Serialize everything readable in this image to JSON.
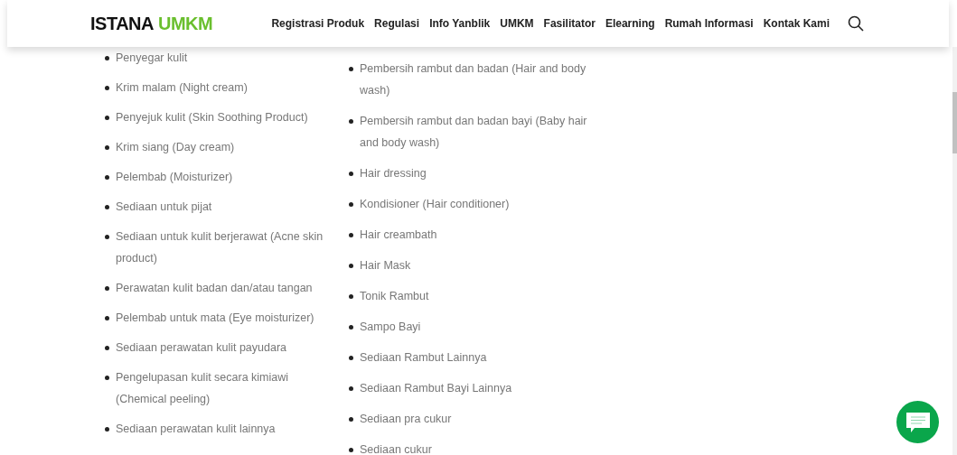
{
  "header": {
    "logo": {
      "part_1": "ISTANA",
      "part_2": "UMKM"
    },
    "nav": [
      "Registrasi Produk",
      "Regulasi",
      "Info Yanblik",
      "UMKM",
      "Fasilitator",
      "Elearning",
      "Rumah Informasi",
      "Kontak Kami"
    ]
  },
  "lists": [
    [
      "Penyegar kulit",
      "Krim malam (Night cream)",
      "Penyejuk kulit (Skin Soothing Product)",
      "Krim siang (Day cream)",
      "Pelembab (Moisturizer)",
      "Sediaan untuk pijat",
      "Sediaan untuk kulit berjerawat (Acne skin product)",
      "Perawatan kulit badan dan/atau tangan",
      "Pelembab untuk mata (Eye moisturizer)",
      "Sediaan perawatan kulit payudara",
      "Pengelupasan kulit secara kimiawi (Chemical peeling)",
      "Sediaan perawatan kulit lainnya"
    ],
    [
      "Pembersih rambut dan badan (Hair and body wash)",
      "Pembersih rambut dan badan bayi (Baby hair and body wash)",
      "Hair dressing",
      "Kondisioner (Hair conditioner)",
      "Hair creambath",
      "Hair Mask",
      "Tonik Rambut",
      "Sampo Bayi",
      "Sediaan Rambut Lainnya",
      "Sediaan Rambut Bayi Lainnya",
      "Sediaan pra cukur",
      "Sediaan cukur"
    ]
  ]
}
